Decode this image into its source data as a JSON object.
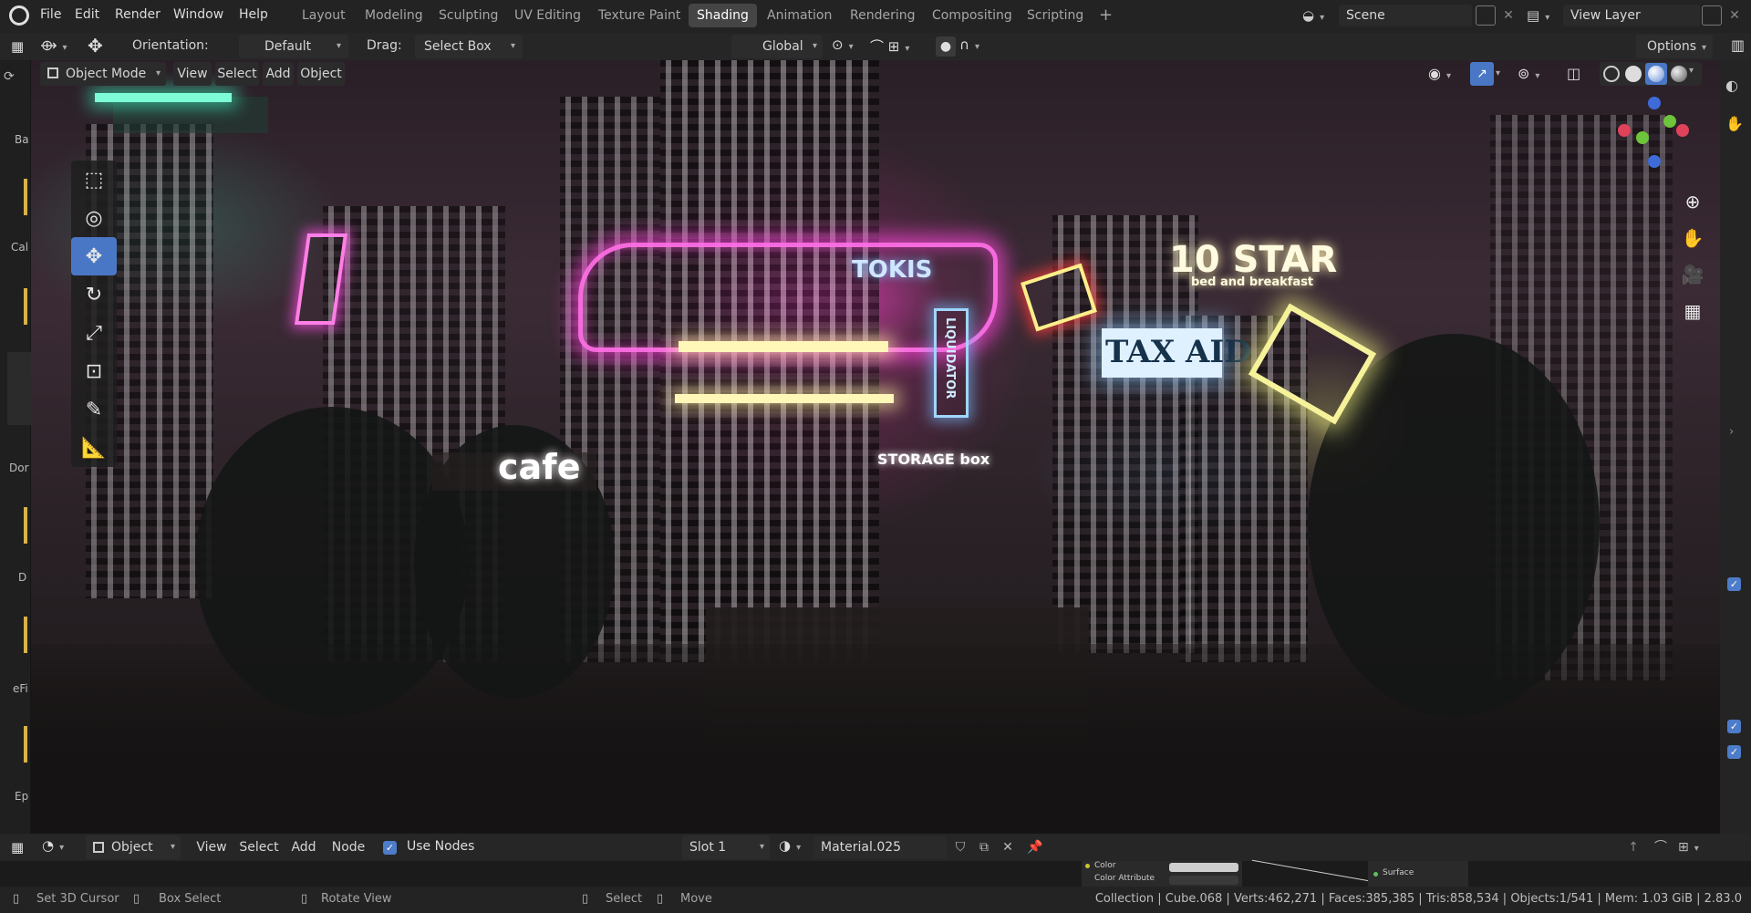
{
  "topbar": {
    "menus": [
      "File",
      "Edit",
      "Render",
      "Window",
      "Help"
    ],
    "workspaces": [
      "Layout",
      "Modeling",
      "Sculpting",
      "UV Editing",
      "Texture Paint",
      "Shading",
      "Animation",
      "Rendering",
      "Compositing",
      "Scripting"
    ],
    "active_workspace": "Shading",
    "add_tab": "+",
    "scene_label": "Scene",
    "view_layer_label": "View Layer"
  },
  "viewport_header": {
    "orientation_label": "Orientation:",
    "orientation_value": "Default",
    "drag_label": "Drag:",
    "drag_value": "Select Box",
    "transform_orientation": "Global",
    "options_label": "Options",
    "mode": "Object Mode",
    "menus": [
      "View",
      "Select",
      "Add",
      "Object"
    ]
  },
  "scene": {
    "signs": {
      "ten_star": "10 STAR",
      "ten_star_sub": "bed and breakfast",
      "tax_aid": "TAX AID",
      "cafe": "cafe",
      "storage": "STORAGE box",
      "liquidator": "LIQUIDATOR",
      "tokis": "TOKIS"
    }
  },
  "shader_header": {
    "editor_type": "Object",
    "menus": [
      "View",
      "Select",
      "Add",
      "Node"
    ],
    "use_nodes_label": "Use Nodes",
    "use_nodes_checked": true,
    "slot": "Slot 1",
    "material": "Material.025"
  },
  "node_strip": {
    "color_label": "Color",
    "color_attribute_label": "Color Attribute",
    "surface_label": "Surface"
  },
  "left_strip_labels": [
    "Ba",
    "Cal",
    "Dor",
    "D",
    "eFi",
    "Ep"
  ],
  "statusbar": {
    "set_cursor": "Set 3D Cursor",
    "box_select": "Box Select",
    "rotate_view": "Rotate View",
    "select": "Select",
    "move": "Move",
    "stats": "Collection | Cube.068 | Verts:462,271 | Faces:385,385 | Tris:858,534 | Objects:1/541 | Mem: 1.03 GiB | 2.83.0"
  },
  "colors": {
    "accent": "#4a77c5",
    "neon_pink": "#ff4fd8",
    "neon_yellow": "#f4ee9a",
    "neon_blue": "#9fd6ff"
  }
}
